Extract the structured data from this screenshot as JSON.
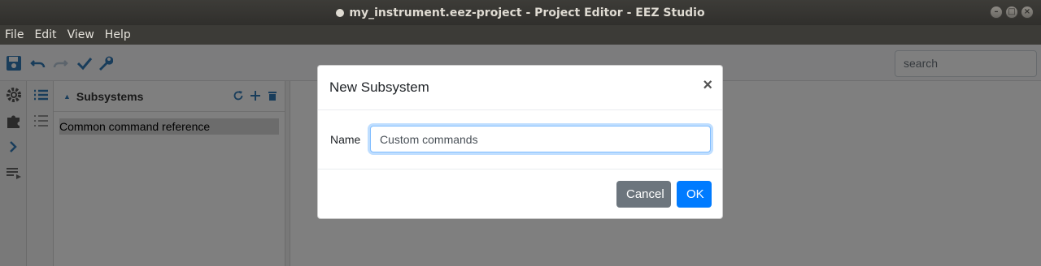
{
  "window": {
    "title": "my_instrument.eez-project - Project Editor - EEZ Studio",
    "controls": [
      "minimize",
      "maximize",
      "close"
    ]
  },
  "menubar": {
    "items": [
      "File",
      "Edit",
      "View",
      "Help"
    ]
  },
  "toolbar": {
    "icons": [
      "save-icon",
      "undo-icon",
      "redo-icon",
      "check-icon",
      "wrench-icon"
    ],
    "search_placeholder": "search"
  },
  "sidebar": {
    "icons": [
      "gear-icon",
      "puzzle-icon",
      "chevron-right-icon",
      "list-play-icon"
    ]
  },
  "secondary_sidebar": {
    "icons": [
      "list-icon",
      "numbered-list-icon"
    ]
  },
  "panel": {
    "title": "Subsystems",
    "actions": [
      "refresh-icon",
      "add-icon",
      "delete-icon"
    ],
    "items": [
      {
        "label": "Common command reference",
        "selected": true
      }
    ]
  },
  "dialog": {
    "title": "New Subsystem",
    "close_glyph": "×",
    "name_label": "Name",
    "name_value": "Custom commands",
    "cancel_label": "Cancel",
    "ok_label": "OK"
  },
  "colors": {
    "primary": "#007bff",
    "secondary": "#6c757d",
    "icon_blue": "#337ab7",
    "titlebar": "#3c3b37"
  }
}
